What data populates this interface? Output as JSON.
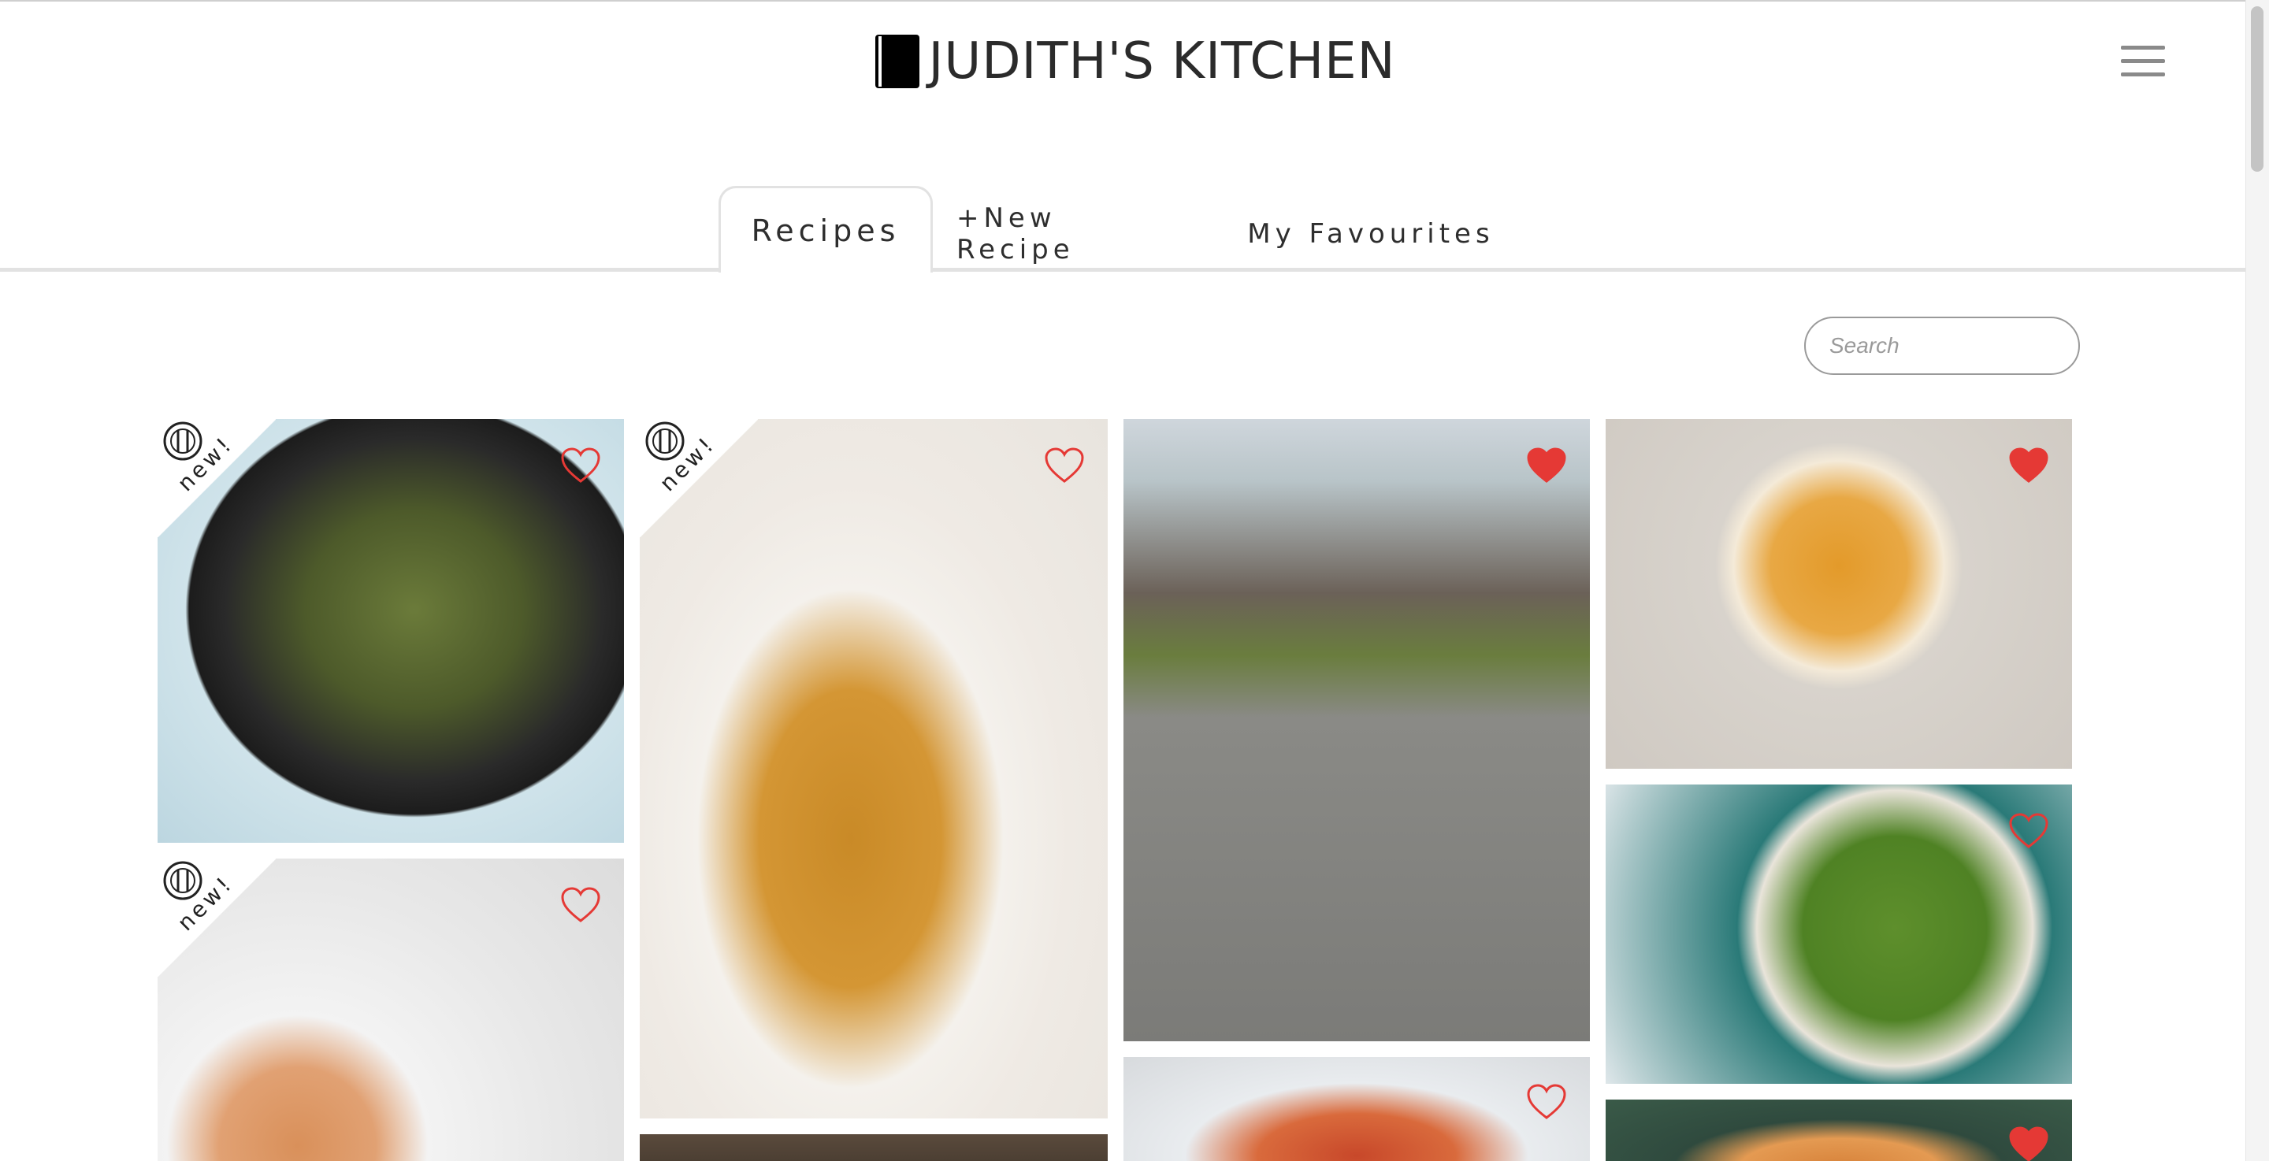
{
  "header": {
    "brand": "JUDITH'S KITCHEN",
    "brand_icon": "book-icon",
    "menu_icon": "hamburger-menu-icon"
  },
  "tabs": [
    {
      "label": "Recipes",
      "active": true
    },
    {
      "label": "+New Recipe",
      "active": false
    },
    {
      "label": "My Favourites",
      "active": false
    }
  ],
  "search": {
    "placeholder": "Search",
    "value": ""
  },
  "recipes": [
    {
      "id": "curry",
      "image": "curry-bowl-photo",
      "favourite": false,
      "new": true
    },
    {
      "id": "dahl",
      "image": "dahl-bowl-photo",
      "favourite": false,
      "new": true
    },
    {
      "id": "dog",
      "image": "dog-with-aubergine-photo",
      "favourite": true,
      "new": false
    },
    {
      "id": "squash-soup",
      "image": "squash-soup-photo",
      "favourite": true,
      "new": false
    },
    {
      "id": "green-soup",
      "image": "green-soup-photo",
      "favourite": false,
      "new": false
    },
    {
      "id": "skewers",
      "image": "tofu-skewers-photo",
      "favourite": false,
      "new": true
    },
    {
      "id": "table",
      "image": "wooden-table-photo",
      "favourite": false,
      "new": false
    },
    {
      "id": "pan",
      "image": "pan-dish-photo",
      "favourite": false,
      "new": false
    },
    {
      "id": "orange-soup",
      "image": "orange-soup-photo",
      "favourite": true,
      "new": false
    }
  ],
  "badges": {
    "new_label": "new!"
  },
  "colors": {
    "heart": "#e53935",
    "tab_border": "#e2e2e2",
    "text": "#2b2b2b"
  }
}
